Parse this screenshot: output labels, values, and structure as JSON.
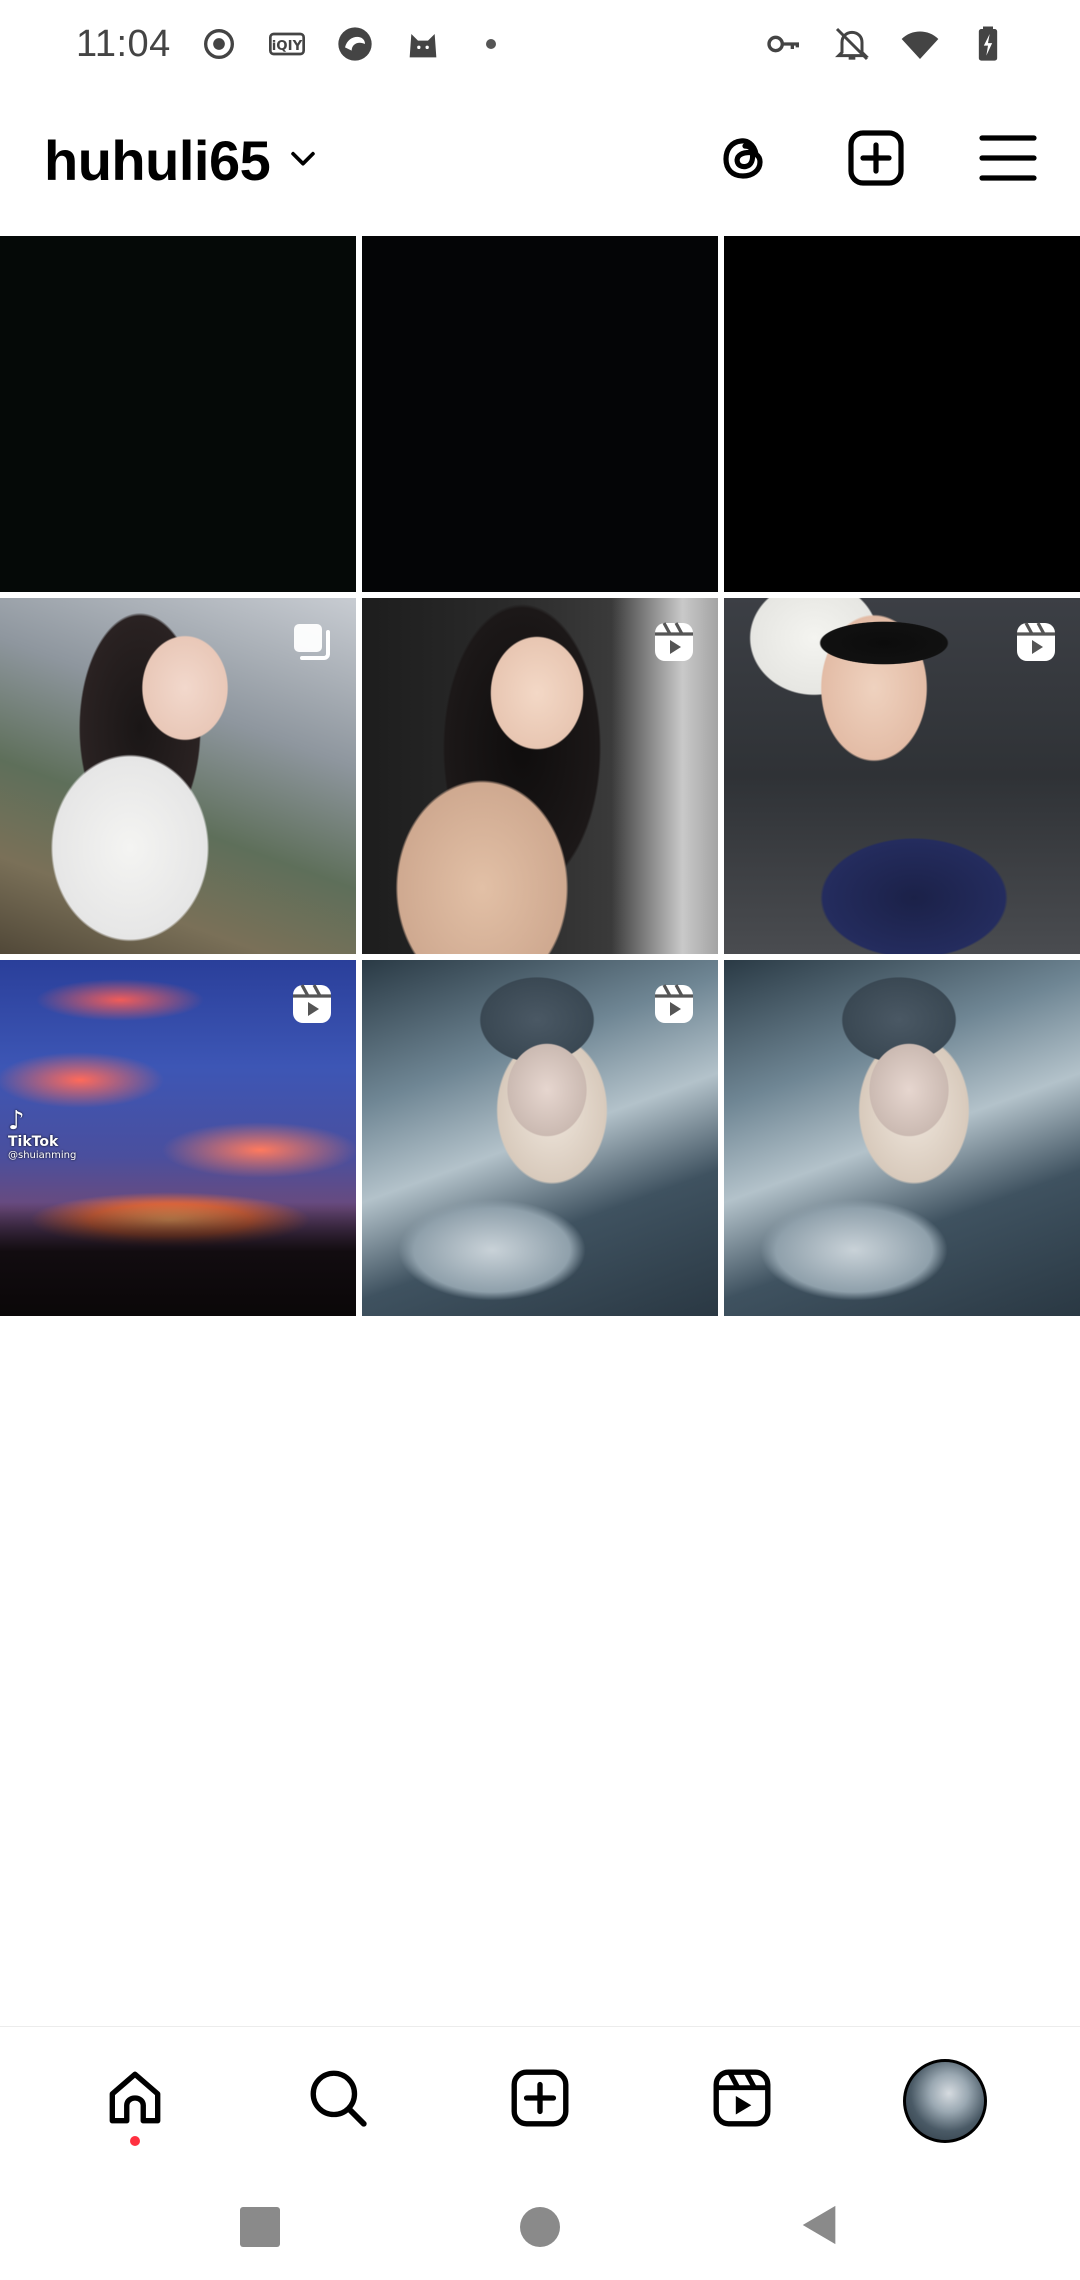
{
  "status_bar": {
    "time": "11:04",
    "left_icons": [
      "record-icon",
      "iqiyi-icon",
      "browser-icon",
      "cat-app-icon",
      "dot-icon"
    ],
    "right_icons": [
      "vpn-key-icon",
      "bell-off-icon",
      "wifi-icon",
      "battery-charging-icon"
    ]
  },
  "header": {
    "username": "huhuli65",
    "actions": [
      "threads-icon",
      "create-post-icon",
      "menu-icon"
    ]
  },
  "grid": {
    "posts": [
      {
        "kind": "photo",
        "badge": null
      },
      {
        "kind": "photo",
        "badge": null
      },
      {
        "kind": "photo",
        "badge": null
      },
      {
        "kind": "photo",
        "badge": "carousel"
      },
      {
        "kind": "reel",
        "badge": "reel"
      },
      {
        "kind": "reel",
        "badge": "reel"
      },
      {
        "kind": "reel",
        "badge": "reel"
      },
      {
        "kind": "reel",
        "badge": "reel"
      },
      {
        "kind": "photo",
        "badge": null
      }
    ]
  },
  "sunset_watermark": {
    "brand": "TikTok",
    "handle": "@shuianming"
  },
  "bottom_nav": {
    "items": [
      "home",
      "search",
      "create",
      "reels",
      "profile"
    ],
    "active": "profile",
    "home_notification": true
  },
  "colors": {
    "accent_notification": "#ff3040",
    "text_primary": "#000000",
    "system_nav": "#8a8a8a"
  }
}
